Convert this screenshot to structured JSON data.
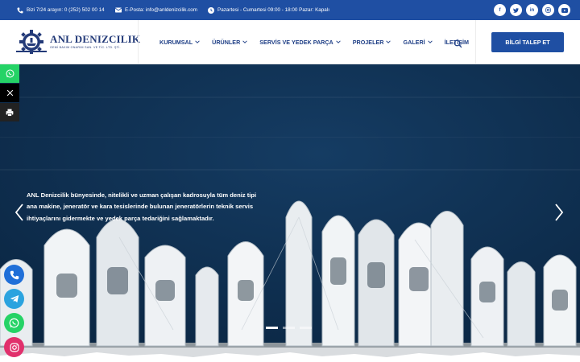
{
  "topbar": {
    "phone": "Bizi 7/24 arayın: 0 (252) 502 00 14",
    "email": "E-Posta: info@anldenizcilik.com",
    "hours": "Pazartesi - Cumartesi 09:00 - 18:00 Pazar: Kapalı",
    "socials": [
      "facebook-icon",
      "twitter-icon",
      "linkedin-icon",
      "instagram-icon",
      "youtube-icon"
    ]
  },
  "logo": {
    "name": "ANL DENIZCILIK",
    "sub": "GEMİ BAKIM ONARIM SAN. VE TİC. LTD. ŞTİ."
  },
  "nav": {
    "items": [
      {
        "label": "KURUMSAL",
        "dropdown": true
      },
      {
        "label": "ÜRÜNLER",
        "dropdown": true
      },
      {
        "label": "SERVİS VE YEDEK PARÇA",
        "dropdown": true
      },
      {
        "label": "PROJELER",
        "dropdown": true
      },
      {
        "label": "GALERİ",
        "dropdown": true
      },
      {
        "label": "İLETİŞİM",
        "dropdown": false
      }
    ],
    "cta": "BİLGİ TALEP ET"
  },
  "hero": {
    "text": "ANL Denizcilik bünyesinde, nitelikli ve uzman çalışan kadrosuyla tüm deniz tipi ana makine, jeneratör ve kara tesislerinde bulunan jeneratörlerin teknik servis ihtiyaçlarını gidermekte ve yedek parça tedariğini sağlamaktadır.",
    "slides_total": 3,
    "active_slide": 1
  },
  "share": [
    "whatsapp-icon",
    "x-icon",
    "print-icon"
  ],
  "contact_fabs": [
    "phone-icon",
    "telegram-icon",
    "whatsapp-icon",
    "instagram-icon"
  ],
  "colors": {
    "brand": "#1f4fa3",
    "nav_text": "#1f3f86",
    "whatsapp": "#25d366",
    "telegram": "#2aa3df",
    "phone": "#1f6fd8",
    "instagram": "#e1306c"
  }
}
